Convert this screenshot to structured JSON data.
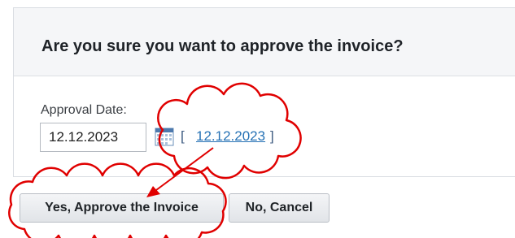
{
  "dialog": {
    "title": "Are you sure you want to approve the invoice?"
  },
  "form": {
    "approval_date_label": "Approval Date:",
    "approval_date_value": "12.12.2023",
    "bracket_open": "[",
    "bracket_close": "]",
    "date_link_text": "12.12.2023",
    "calendar_icon": "calendar-icon"
  },
  "buttons": {
    "approve_label": "Yes, Approve the Invoice",
    "cancel_label": "No, Cancel"
  },
  "annotations": {
    "cloud_color": "#e00000",
    "arrow_color": "#e00000"
  }
}
